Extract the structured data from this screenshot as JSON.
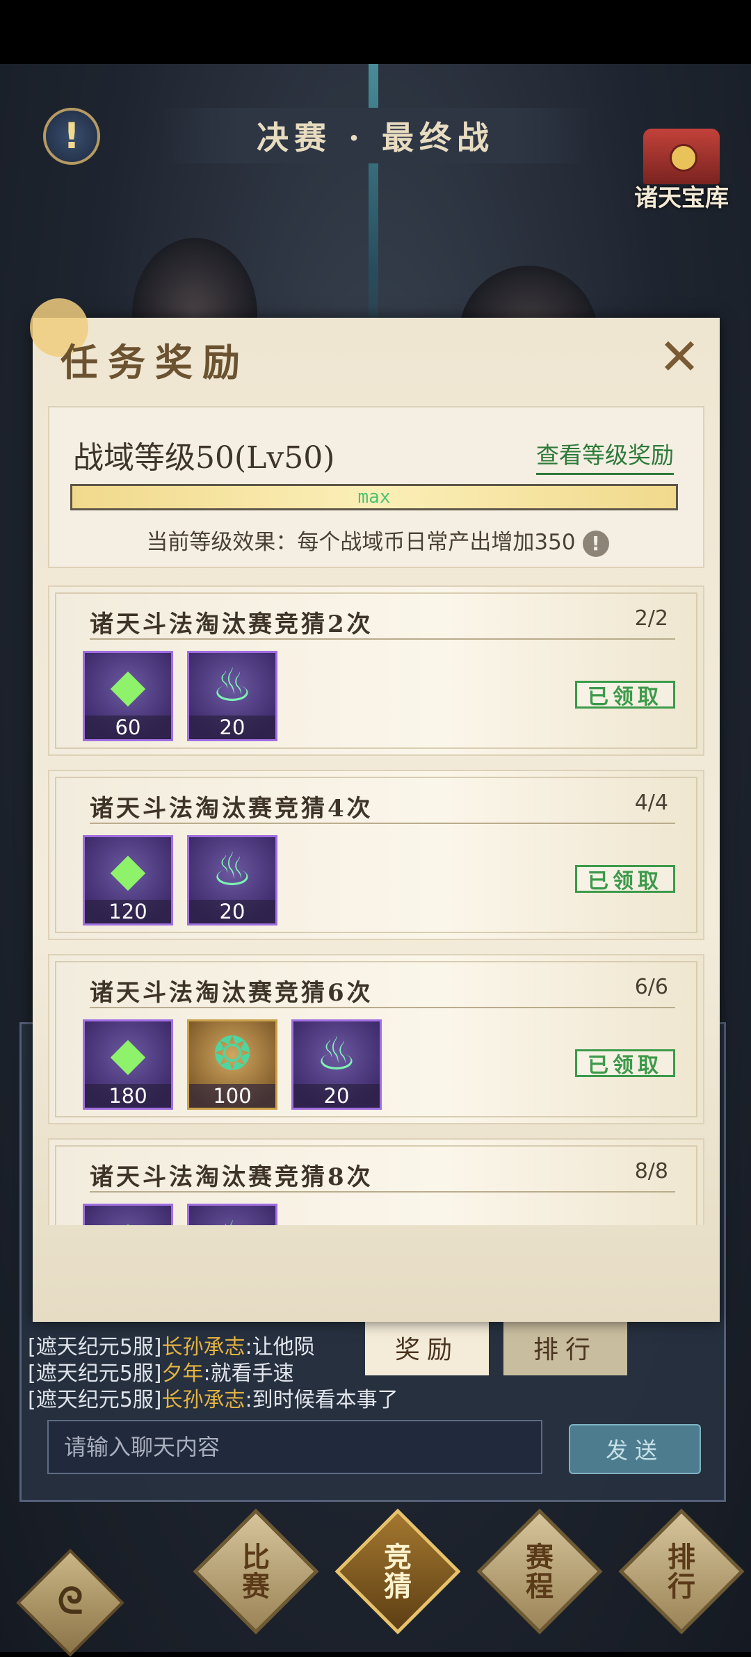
{
  "header": {
    "title": "决赛 · 最终战",
    "info_icon": "!",
    "vault_label": "诸天宝库"
  },
  "modal": {
    "title": "任务奖励",
    "close_icon": "close-icon",
    "level": {
      "text": "战域等级50(Lv50)",
      "link": "查看等级奖励",
      "progress_label": "max",
      "progress_fraction": 1.0,
      "effect_text": "当前等级效果：每个战域币日常产出增加350",
      "effect_icon": "!"
    },
    "tasks": [
      {
        "title": "诸天斗法淘汰赛竞猜2次",
        "progress": "2/2",
        "status": "已领取",
        "rewards": [
          {
            "icon": "green-gem",
            "count": "60"
          },
          {
            "icon": "green-flame",
            "count": "20"
          }
        ]
      },
      {
        "title": "诸天斗法淘汰赛竞猜4次",
        "progress": "4/4",
        "status": "已领取",
        "rewards": [
          {
            "icon": "green-gem",
            "count": "120"
          },
          {
            "icon": "green-flame",
            "count": "20"
          }
        ]
      },
      {
        "title": "诸天斗法淘汰赛竞猜6次",
        "progress": "6/6",
        "status": "已领取",
        "rewards": [
          {
            "icon": "green-gem",
            "count": "180"
          },
          {
            "icon": "jade-pendant",
            "count": "100"
          },
          {
            "icon": "green-flame",
            "count": "20"
          }
        ]
      },
      {
        "title": "诸天斗法淘汰赛竞猜8次",
        "progress": "8/8",
        "status": "",
        "rewards": [
          {
            "icon": "green-gem",
            "count": ""
          },
          {
            "icon": "green-flame",
            "count": ""
          }
        ]
      }
    ]
  },
  "chat": {
    "lines": [
      {
        "server": "[遮天纪元5服]",
        "name": "长孙承志",
        "message": ":让他陨"
      },
      {
        "server": "[遮天纪元5服]",
        "name": "夕年",
        "message": ":就看手速"
      },
      {
        "server": "[遮天纪元5服]",
        "name": "长孙承志",
        "message": ":到时候看本事了"
      }
    ],
    "input_placeholder": "请输入聊天内容",
    "send_label": "发送",
    "tabs": [
      "奖励",
      "排行"
    ]
  },
  "bottom_nav": {
    "items": [
      {
        "label": "比\n赛",
        "active": false
      },
      {
        "label": "竞\n猜",
        "active": true
      },
      {
        "label": "赛\n程",
        "active": false
      },
      {
        "label": "排\n行",
        "active": false
      }
    ]
  }
}
